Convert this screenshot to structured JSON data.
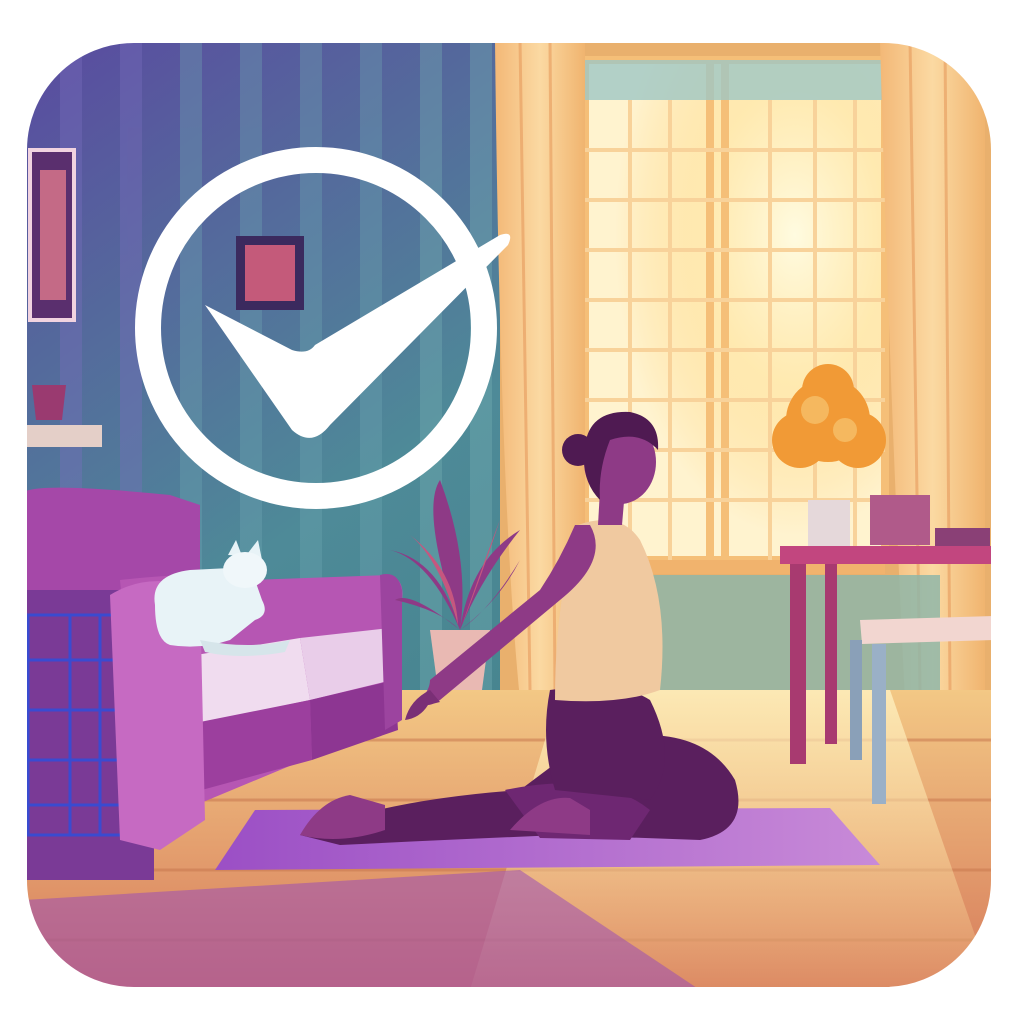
{
  "icon": {
    "description_free": true,
    "colors": {
      "wall_stripe_dark": "#5c4a9e",
      "wall_stripe_teal": "#4f8f9a",
      "wall_stripe_light": "#6fa6ad",
      "curtain": "#f6c886",
      "window_glow": "#fff6c8",
      "floor_light": "#f3c07a",
      "floor_dark": "#d98a5a",
      "sofa": "#a24aa6",
      "sofa_light": "#c46ac0",
      "mat": "#8e4fc2",
      "leggings": "#5a1f5e",
      "tank_top": "#f0c9a0",
      "skin": "#8e3a86",
      "check_white": "#ffffff",
      "plant_orange": "#f19a36",
      "table": "#c2467f"
    },
    "icons": [
      "check-icon",
      "cat-icon",
      "plant-icon",
      "sofa-icon",
      "yoga-person-icon",
      "window-icon",
      "table-icon",
      "picture-frame-icon"
    ]
  }
}
